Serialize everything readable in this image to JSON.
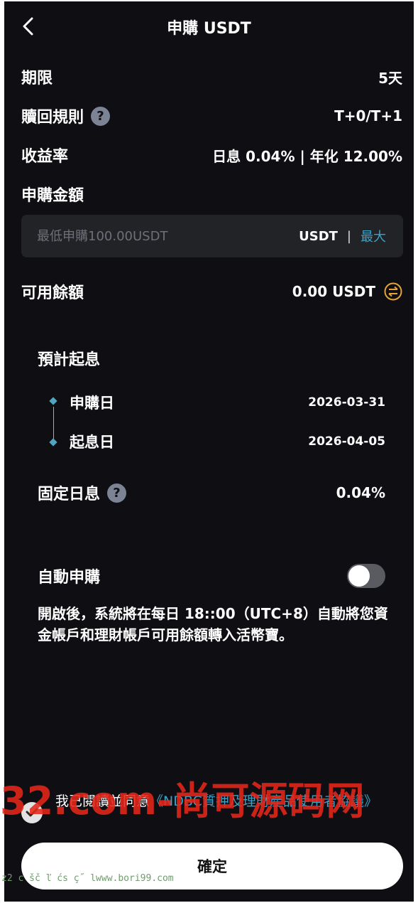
{
  "header": {
    "title": "申購 USDT"
  },
  "term": {
    "label": "期限",
    "value": "5天"
  },
  "redeem": {
    "label": "贖回規則",
    "value": "T+0/T+1",
    "help": "?"
  },
  "yield": {
    "label": "收益率",
    "value": "日息 0.04% | 年化 12.00%"
  },
  "amount": {
    "label": "申購金額",
    "placeholder": "最低申購100.00USDT",
    "value": "",
    "unit": "USDT",
    "separator": "|",
    "max_label": "最大"
  },
  "available": {
    "label": "可用餘額",
    "value": "0.00 USDT",
    "icon": "swap-icon"
  },
  "interest": {
    "title": "預計起息",
    "timeline": [
      {
        "label": "申購日",
        "date": "2026-03-31"
      },
      {
        "label": "起息日",
        "date": "2026-04-05"
      }
    ],
    "fixed_label": "固定日息",
    "fixed_value": "0.04%",
    "help": "?"
  },
  "auto": {
    "label": "自動申購",
    "enabled": false,
    "description": "開啟後，系統將在每日 18::00（UTC+8）自動將您資金帳戶和理財帳戶可用餘額轉入活幣寶。"
  },
  "agreement": {
    "prefix": "我已閱讀並同意",
    "link": "《NDBC質押及理財產品使用者協議》"
  },
  "confirm_label": "確定",
  "watermark": {
    "main": "32.com-尚可源码网",
    "small": "z2 c šč ľ ćs ç˝ lwww.bori99.com"
  },
  "colors": {
    "background": "#0e0e13",
    "accent": "#3aa3c9",
    "gold": "#e3a43a"
  }
}
